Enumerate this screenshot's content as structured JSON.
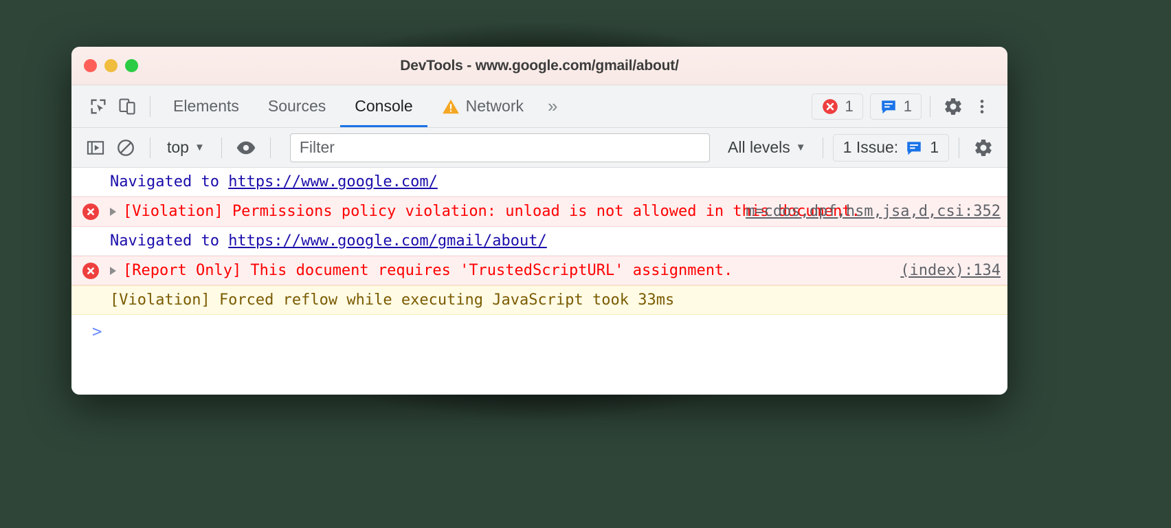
{
  "window": {
    "title": "DevTools - www.google.com/gmail/about/",
    "traffic_lights": [
      "close",
      "minimize",
      "maximize"
    ],
    "colors": {
      "close": "#ff5f57",
      "minimize": "#f0bd3f",
      "maximize": "#2bcc43",
      "accent": "#1a73e8",
      "error": "#ee3f3f",
      "warning": "#f5a623",
      "issue": "#1a73e8"
    }
  },
  "tabbar": {
    "inspect_icon": "inspect-cursor-icon",
    "device_icon": "device-toggle-icon",
    "tabs": [
      {
        "label": "Elements",
        "active": false,
        "icon": null
      },
      {
        "label": "Sources",
        "active": false,
        "icon": null
      },
      {
        "label": "Console",
        "active": true,
        "icon": null
      },
      {
        "label": "Network",
        "active": false,
        "icon": "warning-triangle-icon"
      }
    ],
    "more_tabs": "»",
    "error_badge": {
      "icon": "error-circle-icon",
      "count": "1"
    },
    "issues_badge": {
      "icon": "issues-message-icon",
      "count": "1"
    },
    "settings_icon": "gear-icon",
    "menu_icon": "kebab-menu-icon"
  },
  "console_toolbar": {
    "sidebar_toggle_icon": "console-sidebar-icon",
    "clear_icon": "clear-console-icon",
    "context_selector": "top",
    "context_caret": "▼",
    "eye_icon": "live-expression-eye-icon",
    "filter": {
      "value": "",
      "placeholder": "Filter"
    },
    "level_selector": "All levels",
    "level_caret": "▼",
    "issues_button": {
      "label": "1 Issue:",
      "icon": "issues-message-icon",
      "count": "1"
    },
    "settings_icon": "gear-icon"
  },
  "console": {
    "messages": [
      {
        "type": "info",
        "text_prefix": "Navigated to ",
        "link": "https://www.google.com/",
        "source": null,
        "has_expander": false,
        "icon": null
      },
      {
        "type": "error",
        "text_prefix": "[Violation] Permissions policy violation: unload is not allowed in this document.",
        "link": null,
        "source": "m=cdos,dpf,hsm,jsa,d,csi:352",
        "has_expander": true,
        "icon": "error-circle-icon"
      },
      {
        "type": "info",
        "text_prefix": "Navigated to ",
        "link": "https://www.google.com/gmail/about/",
        "source": null,
        "has_expander": false,
        "icon": null
      },
      {
        "type": "error",
        "text_prefix": "[Report Only] This document requires 'TrustedScriptURL' assignment.",
        "link": null,
        "source": "(index):134",
        "has_expander": true,
        "icon": "error-circle-icon"
      },
      {
        "type": "warning",
        "text_prefix": "[Violation] Forced reflow while executing JavaScript took 33ms",
        "link": null,
        "source": null,
        "has_expander": false,
        "icon": null
      }
    ],
    "prompt": ">"
  }
}
